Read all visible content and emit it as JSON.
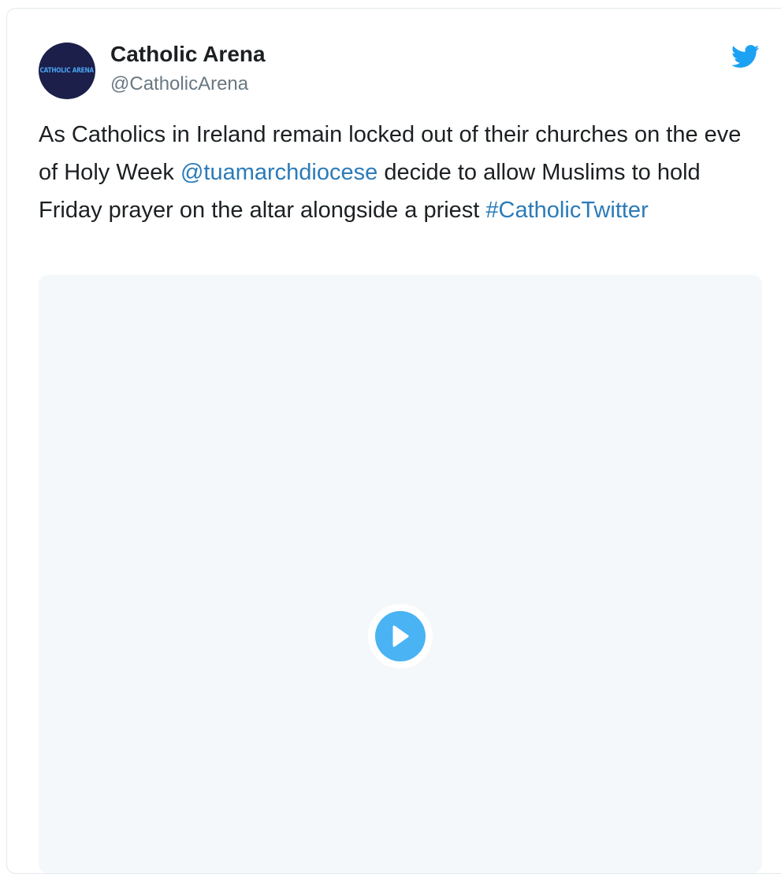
{
  "author": {
    "name": "Catholic Arena",
    "handle": "@CatholicArena",
    "avatar_text": "CATHOLIC ARENA"
  },
  "tweet": {
    "text_before_mention": "As Catholics in Ireland remain locked out of their churches on the eve of Holy Week ",
    "mention": "@tuamarchdiocese",
    "text_after_mention": " decide to allow Muslims to hold Friday prayer on the altar alongside a priest ",
    "hashtag": "#CatholicTwitter"
  },
  "media": {
    "type": "video",
    "play_icon": "play-icon"
  },
  "colors": {
    "link": "#2b7bb9",
    "twitter_blue": "#1da1f2",
    "play_button": "#4ab3f4",
    "media_bg": "#f5f8fa",
    "avatar_bg": "#1b1f4a"
  },
  "icons": {
    "brand": "twitter-bird-icon"
  }
}
